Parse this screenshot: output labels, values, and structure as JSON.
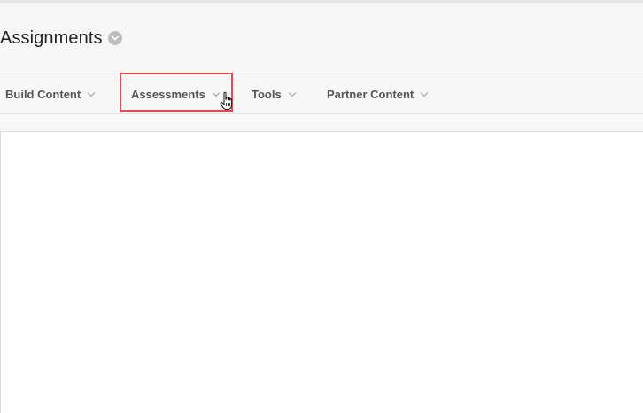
{
  "page": {
    "title": "Assignments"
  },
  "toolbar": {
    "items": [
      {
        "label": "Build Content",
        "icon": "chevron-down-icon"
      },
      {
        "label": "Assessments",
        "icon": "chevron-down-icon"
      },
      {
        "label": "Tools",
        "icon": "chevron-down-icon"
      },
      {
        "label": "Partner Content",
        "icon": "chevron-down-icon"
      }
    ]
  },
  "colors": {
    "highlight": "#e8494f",
    "background": "#f7f7f7",
    "content": "#ffffff"
  }
}
